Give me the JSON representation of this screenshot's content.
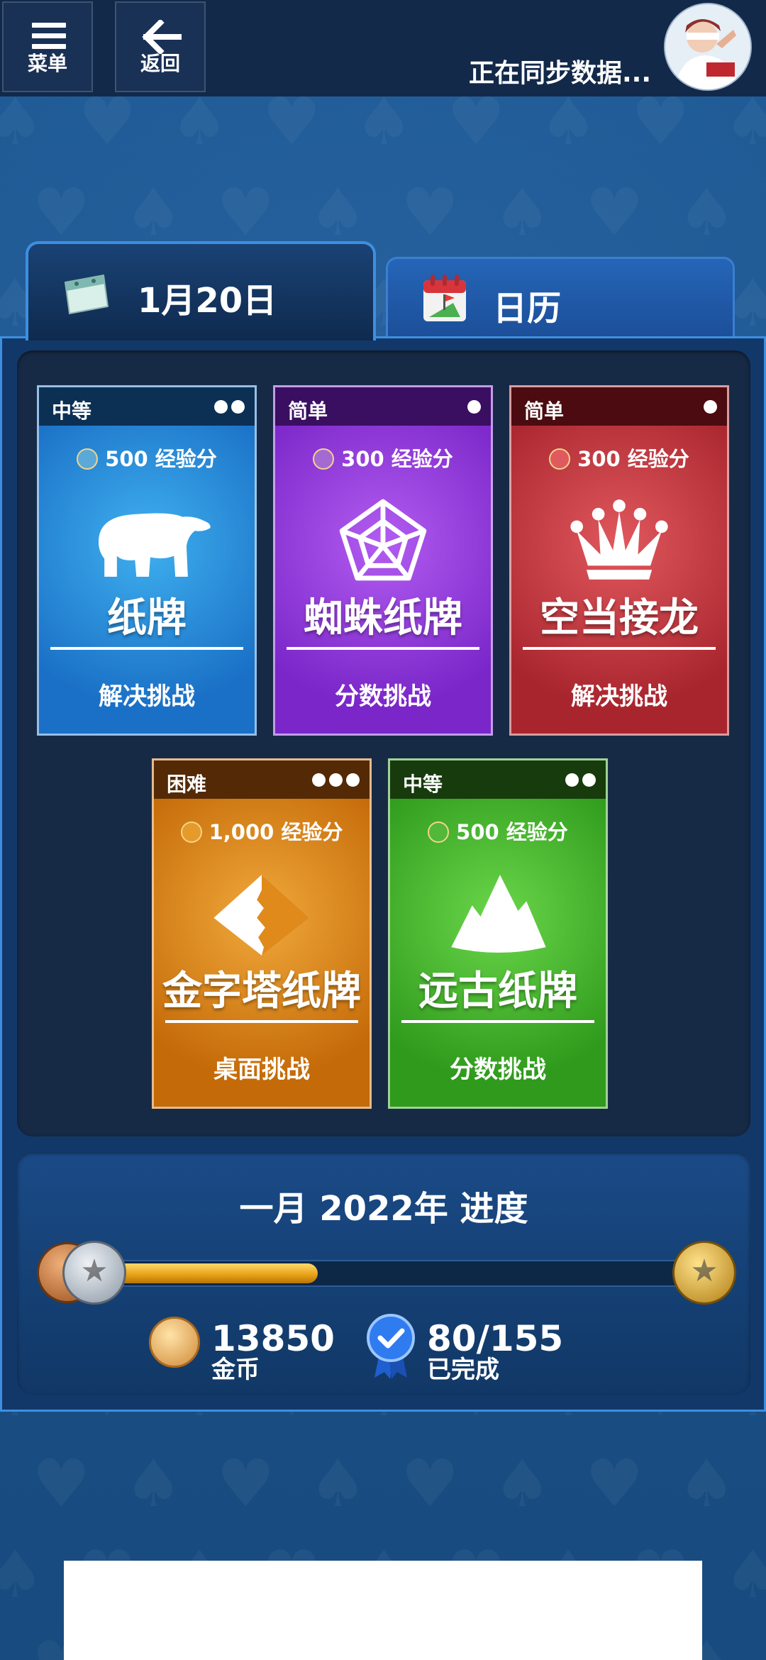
{
  "topbar": {
    "menu_label": "菜单",
    "back_label": "返回",
    "sync_status": "正在同步数据..."
  },
  "tabs": {
    "today_label": "1月20日",
    "calendar_label": "日历"
  },
  "challenges": [
    {
      "difficulty": "中等",
      "dots": 2,
      "xp": "500 经验分",
      "title": "纸牌",
      "subtitle": "解决挑战",
      "icon": "polar-bear-icon"
    },
    {
      "difficulty": "简单",
      "dots": 1,
      "xp": "300 经验分",
      "title": "蜘蛛纸牌",
      "subtitle": "分数挑战",
      "icon": "spider-web-icon"
    },
    {
      "difficulty": "简单",
      "dots": 1,
      "xp": "300 经验分",
      "title": "空当接龙",
      "subtitle": "解决挑战",
      "icon": "crown-icon"
    },
    {
      "difficulty": "困难",
      "dots": 3,
      "xp": "1,000 经验分",
      "title": "金字塔纸牌",
      "subtitle": "桌面挑战",
      "icon": "pyramid-icon"
    },
    {
      "difficulty": "中等",
      "dots": 2,
      "xp": "500 经验分",
      "title": "远古纸牌",
      "subtitle": "分数挑战",
      "icon": "mountain-icon"
    }
  ],
  "progress": {
    "title": "一月 2022年 进度",
    "fill_fraction": 0.36,
    "coins_value": "13850",
    "coins_label": "金币",
    "completed_value": "80/155",
    "completed_label": "已完成"
  },
  "colors": {
    "accent": "#3d8fe0",
    "klondike": "#1a70c6",
    "spider": "#7a26c9",
    "freecell": "#a9252e",
    "pyramid": "#c46a08",
    "tripeaks": "#2f9a1c"
  }
}
